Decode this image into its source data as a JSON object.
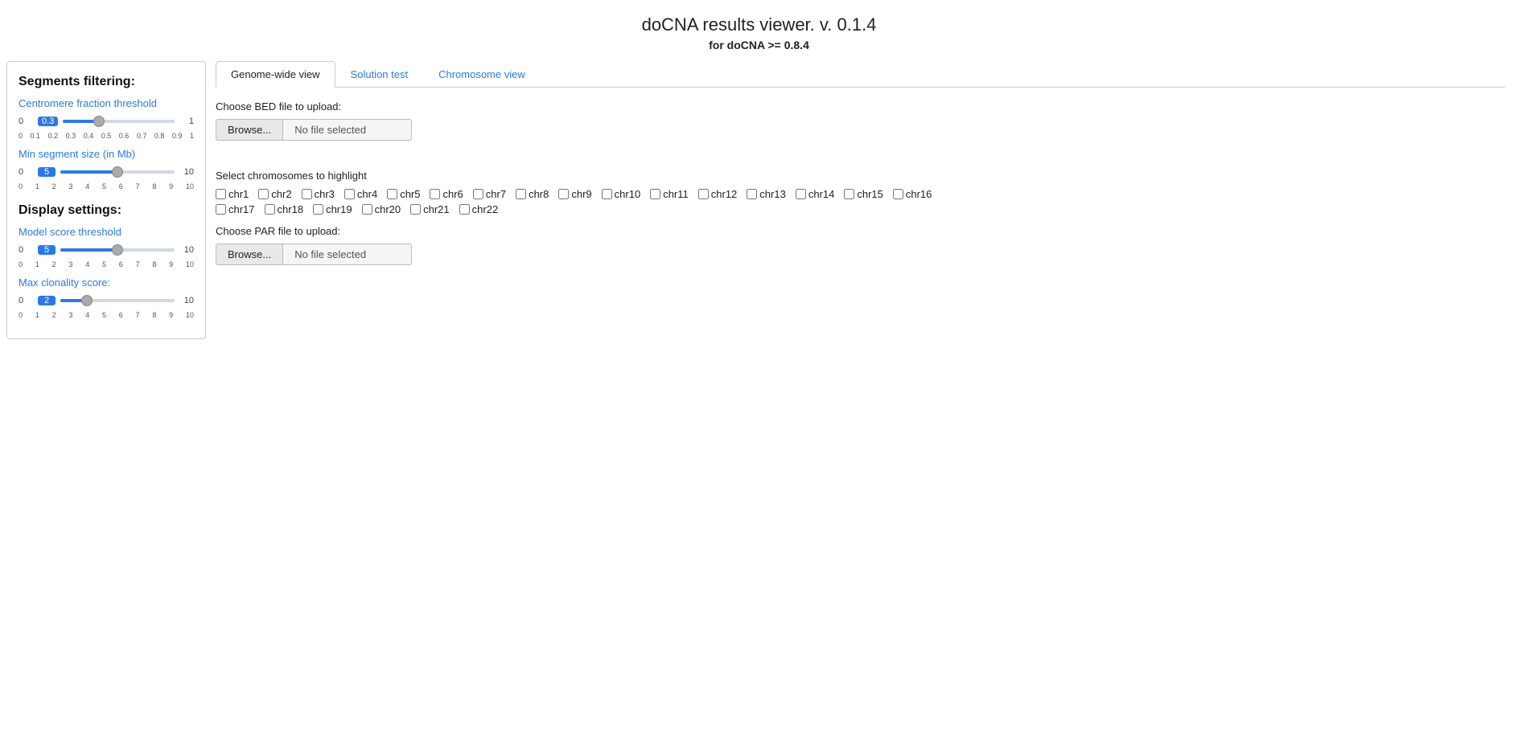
{
  "app": {
    "title": "doCNA results viewer. v. 0.1.4",
    "subtitle": "for doCNA >= 0.8.4"
  },
  "tabs": [
    {
      "id": "genome-wide",
      "label": "Genome-wide view",
      "active": true
    },
    {
      "id": "solution-test",
      "label": "Solution test",
      "active": false
    },
    {
      "id": "chromosome-view",
      "label": "Chromosome view",
      "active": false
    }
  ],
  "main": {
    "bed_label": "Choose BED file to upload:",
    "bed_browse": "Browse...",
    "bed_filename": "No file selected",
    "par_label": "Choose PAR file to upload:",
    "par_browse": "Browse...",
    "par_filename": "No file selected",
    "chromosomes_label": "Select chromosomes to highlight",
    "chromosomes": [
      "chr1",
      "chr2",
      "chr3",
      "chr4",
      "chr5",
      "chr6",
      "chr7",
      "chr8",
      "chr9",
      "chr10",
      "chr11",
      "chr12",
      "chr13",
      "chr14",
      "chr15",
      "chr16",
      "chr17",
      "chr18",
      "chr19",
      "chr20",
      "chr21",
      "chr22"
    ]
  },
  "sidebar": {
    "segments_title": "Segments filtering:",
    "centromere_label": "Centromere fraction threshold",
    "centromere_min": "0",
    "centromere_val": "0.3",
    "centromere_max": "1",
    "centromere_ticks": [
      "0",
      "0.1",
      "0.2",
      "0.3",
      "0.4",
      "0.5",
      "0.6",
      "0.7",
      "0.8",
      "0.9",
      "1"
    ],
    "minseg_label": "Min segment size (in Mb)",
    "minseg_min": "0",
    "minseg_val": "5",
    "minseg_max": "10",
    "minseg_ticks": [
      "0",
      "1",
      "2",
      "3",
      "4",
      "5",
      "6",
      "7",
      "8",
      "9",
      "10"
    ],
    "display_title": "Display settings:",
    "model_label": "Model score threshold",
    "model_min": "0",
    "model_val": "5",
    "model_max": "10",
    "model_ticks": [
      "0",
      "1",
      "2",
      "3",
      "4",
      "5",
      "6",
      "7",
      "8",
      "9",
      "10"
    ],
    "clonality_label": "Max clonality score:",
    "clonality_min": "0",
    "clonality_val": "2",
    "clonality_max": "10",
    "clonality_ticks": [
      "0",
      "1",
      "2",
      "3",
      "4",
      "5",
      "6",
      "7",
      "8",
      "9",
      "10"
    ]
  }
}
